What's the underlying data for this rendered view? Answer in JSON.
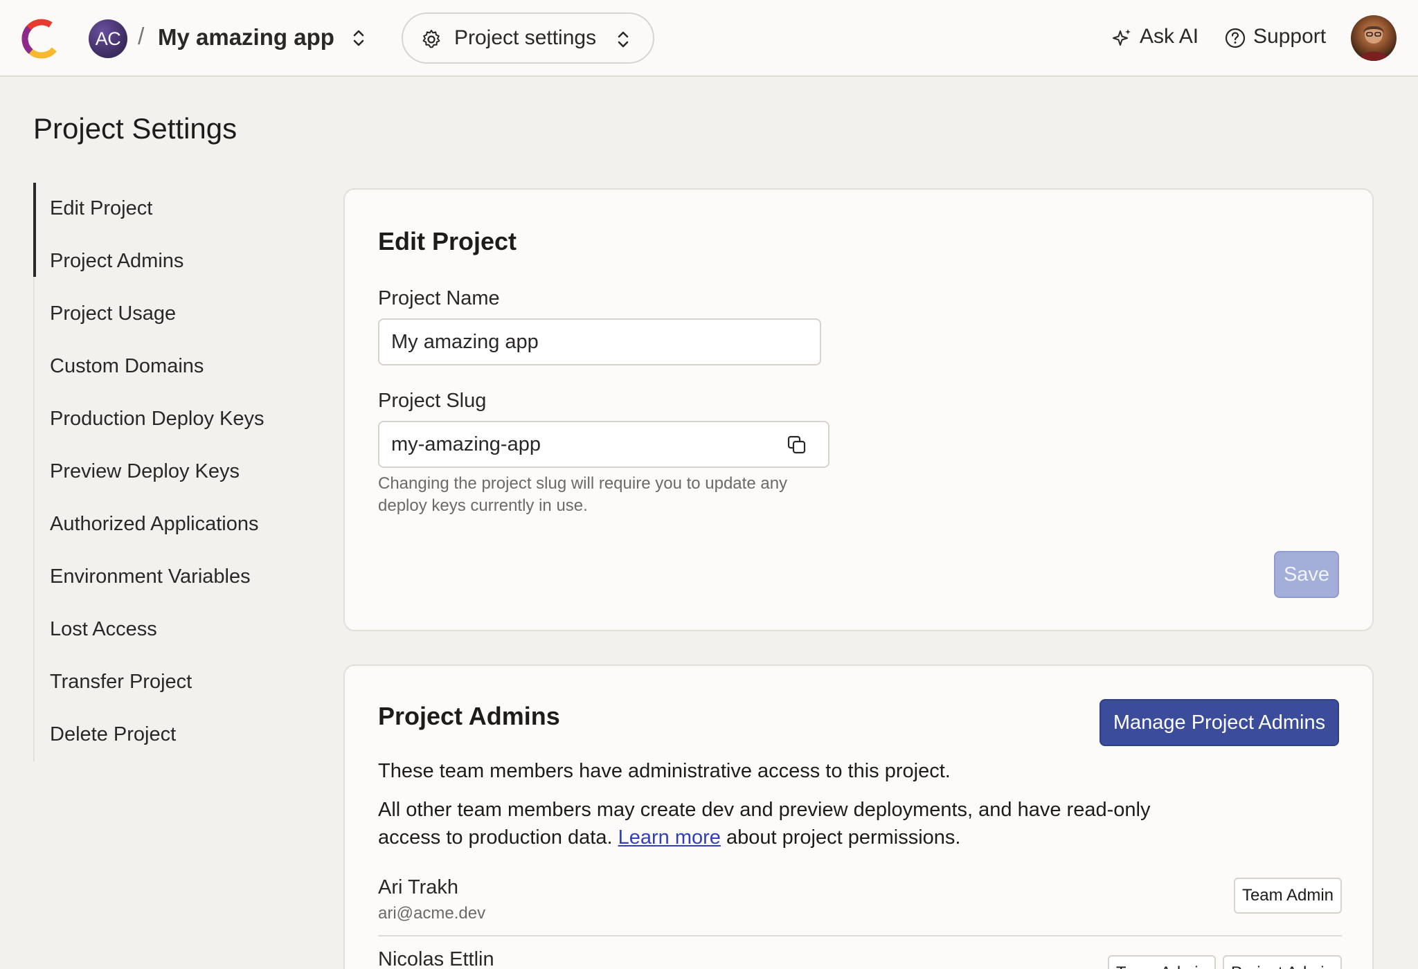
{
  "header": {
    "team_initials": "AC",
    "separator": "/",
    "app_name": "My amazing app",
    "project_settings_label": "Project settings",
    "ask_ai_label": "Ask AI",
    "support_label": "Support",
    "icons": [
      "convex-logo",
      "chevron-up-down-icon",
      "gear-icon",
      "sparkle-icon",
      "help-circle-icon"
    ]
  },
  "page_title": "Project Settings",
  "sidebar": {
    "active": "Edit Project",
    "items": [
      {
        "label": "Edit Project"
      },
      {
        "label": "Project Admins"
      },
      {
        "label": "Project Usage"
      },
      {
        "label": "Custom Domains"
      },
      {
        "label": "Production Deploy Keys"
      },
      {
        "label": "Preview Deploy Keys"
      },
      {
        "label": "Authorized Applications"
      },
      {
        "label": "Environment Variables"
      },
      {
        "label": "Lost Access"
      },
      {
        "label": "Transfer Project"
      },
      {
        "label": "Delete Project"
      }
    ]
  },
  "edit_project": {
    "title": "Edit Project",
    "name_label": "Project Name",
    "name_value": "My amazing app",
    "slug_label": "Project Slug",
    "slug_value": "my-amazing-app",
    "slug_help": "Changing the project slug will require you to update any deploy keys currently in use.",
    "save_label": "Save"
  },
  "project_admins": {
    "title": "Project Admins",
    "manage_label": "Manage Project Admins",
    "desc1": "These team members have administrative access to this project.",
    "desc2_before": "All other team members may create dev and preview deployments, and have read-only access to production data. ",
    "desc2_link": "Learn more",
    "desc2_after": " about project permissions.",
    "admins": [
      {
        "name": "Ari Trakh",
        "email": "ari@acme.dev",
        "roles": [
          "Team Admin"
        ]
      },
      {
        "name": "Nicolas Ettlin",
        "email": "",
        "roles": [
          "Team Admin",
          "Project Admin"
        ]
      }
    ]
  },
  "colors": {
    "accent": "#3b4d9a",
    "disabled_button": "#a3aed9",
    "link": "#2f3fbd",
    "background": "#f3f1ee"
  }
}
